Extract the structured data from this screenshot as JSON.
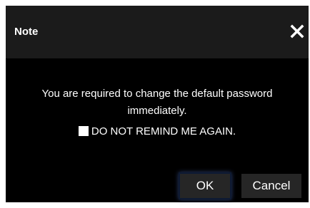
{
  "dialog": {
    "title": "Note",
    "message": "You are required to change the default password immediately.",
    "checkbox_label": "DO NOT REMIND ME AGAIN.",
    "checkbox_checked": false,
    "ok_label": "OK",
    "cancel_label": "Cancel"
  },
  "icons": {
    "close": "close-icon"
  },
  "colors": {
    "background": "#000000",
    "titlebar": "#1b1b1b",
    "button": "#262626",
    "text": "#ffffff",
    "ok_glow": "#2b3e6e"
  }
}
